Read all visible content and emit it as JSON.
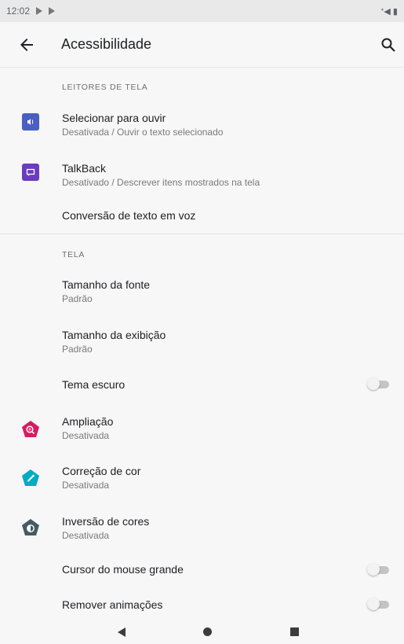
{
  "status_bar": {
    "time": "12:02",
    "right": "ᐩ◀ ▮"
  },
  "app_bar": {
    "title": "Acessibilidade"
  },
  "sections": {
    "screen_readers": {
      "header": "LEITORES DE TELA",
      "items": [
        {
          "primary": "Selecionar para ouvir",
          "secondary": "Desativada / Ouvir o texto selecionado",
          "icon": "select-to-speak-icon",
          "icon_color": "#4a5fc1"
        },
        {
          "primary": "TalkBack",
          "secondary": "Desativado / Descrever itens mostrados na tela",
          "icon": "talkback-icon",
          "icon_color": "#6a3cc0"
        },
        {
          "primary": "Conversão de texto em voz"
        }
      ]
    },
    "display": {
      "header": "TELA",
      "items": [
        {
          "primary": "Tamanho da fonte",
          "secondary": "Padrão"
        },
        {
          "primary": "Tamanho da exibição",
          "secondary": "Padrão"
        },
        {
          "primary": "Tema escuro",
          "toggle": false
        },
        {
          "primary": "Ampliação",
          "secondary": "Desativada",
          "icon": "magnification-icon",
          "icon_color": "#d81b60"
        },
        {
          "primary": "Correção de cor",
          "secondary": "Desativada",
          "icon": "color-correction-icon",
          "icon_color": "#00acc1"
        },
        {
          "primary": "Inversão de cores",
          "secondary": "Desativada",
          "icon": "color-inversion-icon",
          "icon_color": "#455a64"
        },
        {
          "primary": "Cursor do mouse grande",
          "toggle": false
        },
        {
          "primary": "Remover animações",
          "toggle": false
        }
      ]
    }
  }
}
